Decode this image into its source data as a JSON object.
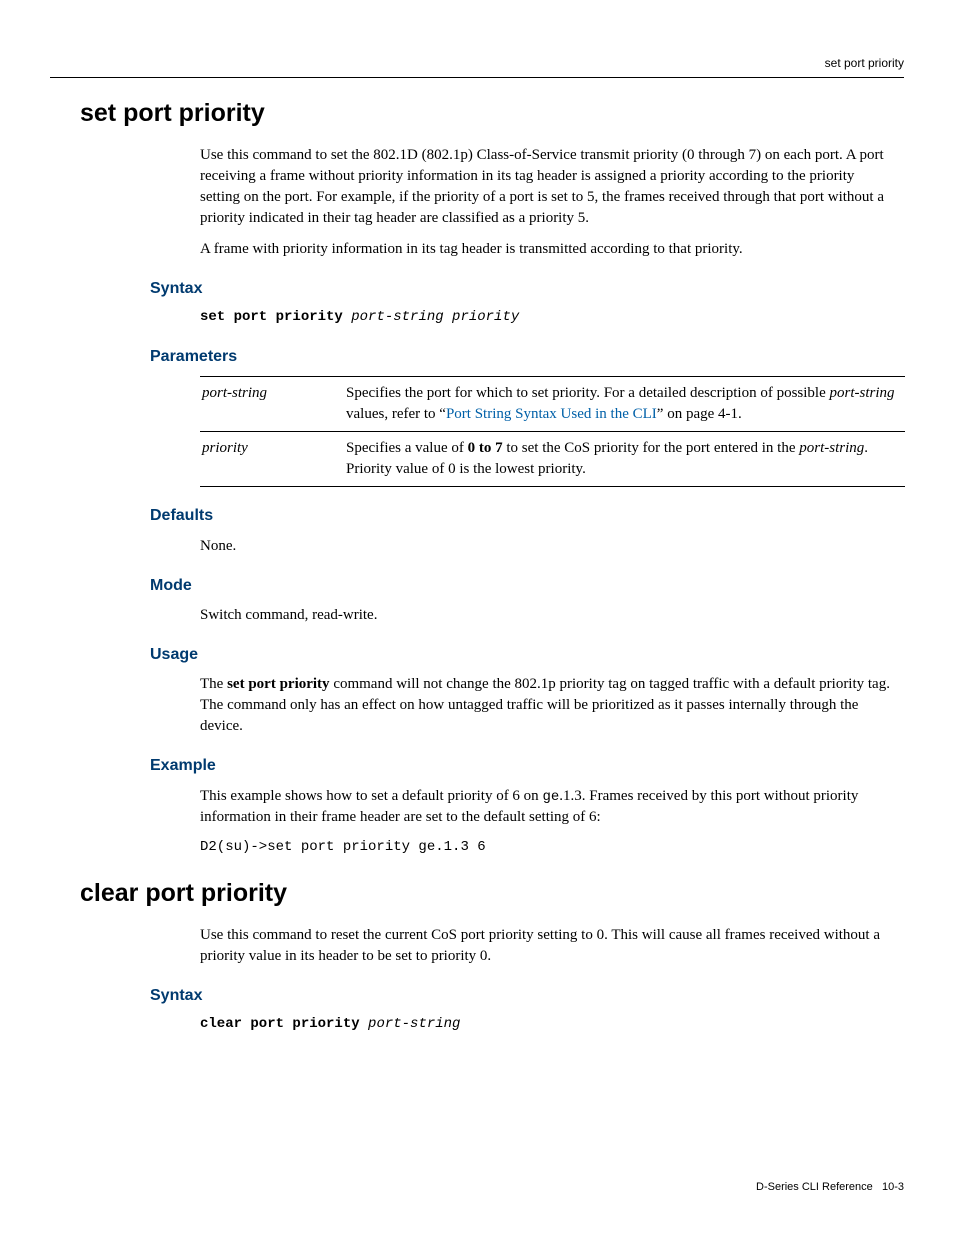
{
  "header": {
    "right": "set port priority"
  },
  "footer": {
    "left": "D-Series CLI Reference",
    "right": "10-3"
  },
  "sec1": {
    "title": "set port priority",
    "intro_p1": "Use this command to set the 802.1D (802.1p) Class-of-Service transmit priority (0 through 7) on each port. A port receiving a frame without priority information in its tag header is assigned a priority according to the priority setting on the port. For example, if the priority of a port is set to 5, the frames received through that port without a priority indicated in their tag header are classified as a priority 5.",
    "intro_p2": "A frame with priority information in its tag header is transmitted according to that priority.",
    "syntax_h": "Syntax",
    "syntax_cmd": "set port priority",
    "syntax_args": "port-string priority",
    "params_h": "Parameters",
    "param1_name": "port-string",
    "param1_desc_a": "Specifies the port for which to set priority. For a detailed description of possible ",
    "param1_desc_b": "port-string",
    "param1_desc_c": " values, refer to “",
    "param1_desc_link": "Port String Syntax Used in the CLI",
    "param1_desc_d": "” on page 4-1.",
    "param2_name": "priority",
    "param2_desc_a": "Specifies a value of ",
    "param2_desc_b": "0 to 7",
    "param2_desc_c": " to set the CoS priority for the port entered in the ",
    "param2_desc_d": "port-string",
    "param2_desc_e": ". Priority value of 0 is the lowest priority.",
    "defaults_h": "Defaults",
    "defaults_p": "None.",
    "mode_h": "Mode",
    "mode_p": "Switch command, read-write.",
    "usage_h": "Usage",
    "usage_a": "The ",
    "usage_b": "set port priority",
    "usage_c": " command will not change the 802.1p priority tag on tagged traffic with a default priority tag.  The command only has an effect on how untagged traffic will be prioritized as it passes internally through the device.",
    "example_h": "Example",
    "example_a": "This example shows how to set a default priority of 6 on ",
    "example_b": "ge",
    "example_c": ".1.3. Frames received by this port without priority information in their frame header are set to the default setting of 6:",
    "example_code": "D2(su)->set port priority ge.1.3 6"
  },
  "sec2": {
    "title": "clear port priority",
    "intro_p1": "Use this command to reset the current CoS port priority setting to 0. This will cause all frames received without a priority value in its header to be set to priority 0.",
    "syntax_h": "Syntax",
    "syntax_cmd": "clear port priority",
    "syntax_args": "port-string"
  }
}
